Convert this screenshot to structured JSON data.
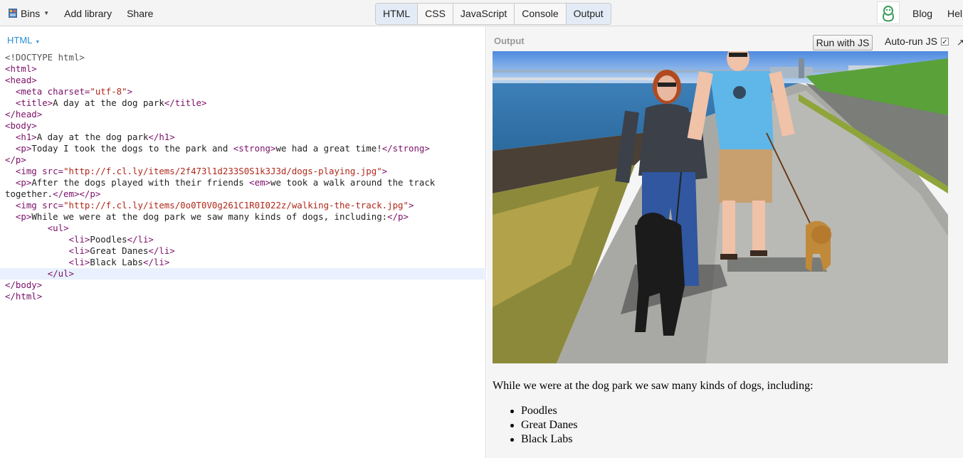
{
  "topbar": {
    "bins_label": "Bins",
    "add_library": "Add library",
    "share": "Share",
    "tabs": [
      "HTML",
      "CSS",
      "JavaScript",
      "Console",
      "Output"
    ],
    "active_tabs": [
      "HTML",
      "Output"
    ],
    "blog": "Blog",
    "help": "Help"
  },
  "editor": {
    "panel_label": "HTML",
    "lines": [
      "<!DOCTYPE html>",
      "<html>",
      "<head>",
      "  <meta charset=\"utf-8\">",
      "  <title>A day at the dog park</title>",
      "</head>",
      "<body>",
      "  <h1>A day at the dog park</h1>",
      "  <p>Today I took the dogs to the park and <strong>we had a great time!</strong>",
      "</p>",
      "  <img src=\"http://f.cl.ly/items/2f473l1d233S0S1k3J3d/dogs-playing.jpg\">",
      "  <p>After the dogs played with their friends <em>we took a walk around the track together.</em></p>",
      "  <img src=\"http://f.cl.ly/items/0o0T0V0g261C1R0I022z/walking-the-track.jpg\">",
      "  <p>While we were at the dog park we saw many kinds of dogs, including:</p>",
      "        <ul>",
      "            <li>Poodles</li>",
      "            <li>Great Danes</li>",
      "            <li>Black Labs</li>",
      "        </ul>",
      "</body>",
      "</html>"
    ]
  },
  "output": {
    "label": "Output",
    "run_button": "Run with JS",
    "autorun_label": "Auto-run JS",
    "autorun_checked": true,
    "paragraph": "While we were at the dog park we saw many kinds of dogs, including:",
    "list": [
      "Poodles",
      "Great Danes",
      "Black Labs"
    ]
  },
  "colors": {
    "accent": "#2a8fd6",
    "tag": "#7b0f68",
    "string": "#b0281a",
    "active_tab": "#e3ecf6",
    "highlight_line": "#e8f1fd"
  }
}
